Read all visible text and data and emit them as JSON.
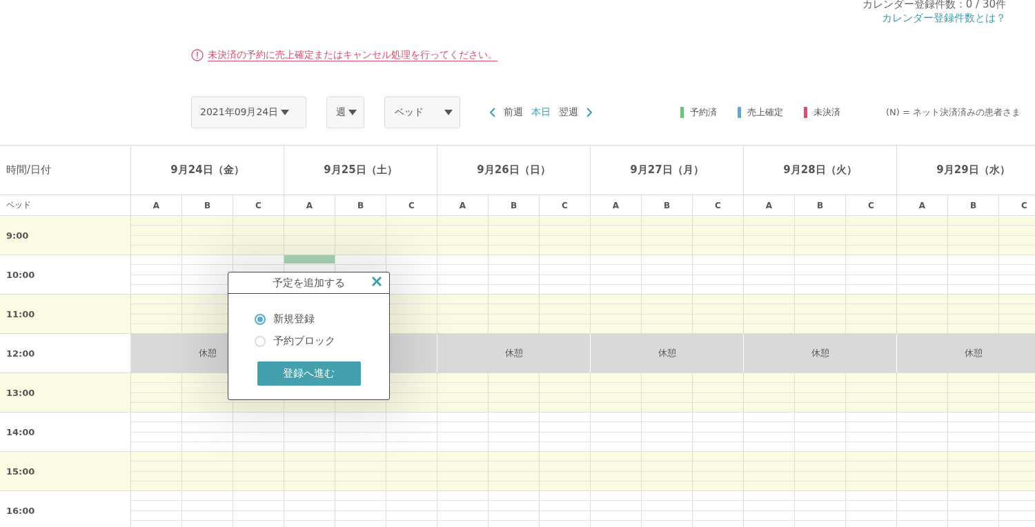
{
  "header": {
    "count": "カレンダー登録件数：0 / 30件",
    "help_link": "カレンダー登録件数とは？"
  },
  "alert": {
    "text": "未決済の予約に売上確定またはキャンセル処理を行ってください。"
  },
  "toolbar": {
    "date": "2021年09月24日",
    "view": "週",
    "group": "ベッド",
    "prev": "前週",
    "today": "本日",
    "next": "翌週"
  },
  "legend": [
    {
      "label": "予約済",
      "color": "#6cc17e"
    },
    {
      "label": "売上確定",
      "color": "#5aaad6"
    },
    {
      "label": "未決済",
      "color": "#e04c6c"
    }
  ],
  "legend_note": "(N) = ネット決済済みの患者さま",
  "grid": {
    "corner": "時間/日付",
    "bed_label": "ベッド",
    "days": [
      {
        "label": "9月24日（金）",
        "beds": [
          "A",
          "B",
          "C"
        ],
        "break_label": "休憩"
      },
      {
        "label": "9月25日（土）",
        "beds": [
          "A",
          "B",
          "C"
        ]
      },
      {
        "label": "9月26日（日）",
        "beds": [
          "A",
          "B",
          "C"
        ],
        "break_label": "休憩"
      },
      {
        "label": "9月27日（月）",
        "beds": [
          "A",
          "B",
          "C"
        ],
        "break_label": "休憩"
      },
      {
        "label": "9月28日（火）",
        "beds": [
          "A",
          "B",
          "C"
        ],
        "break_label": "休憩"
      },
      {
        "label": "9月29日（水）",
        "beds": [
          "A",
          "B",
          "C"
        ],
        "break_label": "休憩"
      }
    ],
    "hours": [
      {
        "time": "9:00",
        "kind": "slot",
        "shaded": true
      },
      {
        "time": "10:00",
        "kind": "slot",
        "shaded": false,
        "booked": [
          [
            false,
            false,
            false
          ],
          [
            true,
            false,
            false
          ],
          [
            false,
            false,
            false
          ],
          [
            false,
            false,
            false
          ],
          [
            false,
            false,
            false
          ],
          [
            false,
            false,
            false
          ]
        ]
      },
      {
        "time": "11:00",
        "kind": "slot",
        "shaded": true
      },
      {
        "time": "12:00",
        "kind": "break",
        "shaded": false
      },
      {
        "time": "13:00",
        "kind": "slot",
        "shaded": true
      },
      {
        "time": "14:00",
        "kind": "slot",
        "shaded": false
      },
      {
        "time": "15:00",
        "kind": "slot",
        "shaded": true
      },
      {
        "time": "16:00",
        "kind": "slot",
        "shaded": false
      }
    ]
  },
  "modal": {
    "title": "予定を追加する",
    "options": [
      {
        "label": "新規登録",
        "selected": true
      },
      {
        "label": "予約ブロック",
        "selected": false
      }
    ],
    "submit": "登録へ進む"
  }
}
